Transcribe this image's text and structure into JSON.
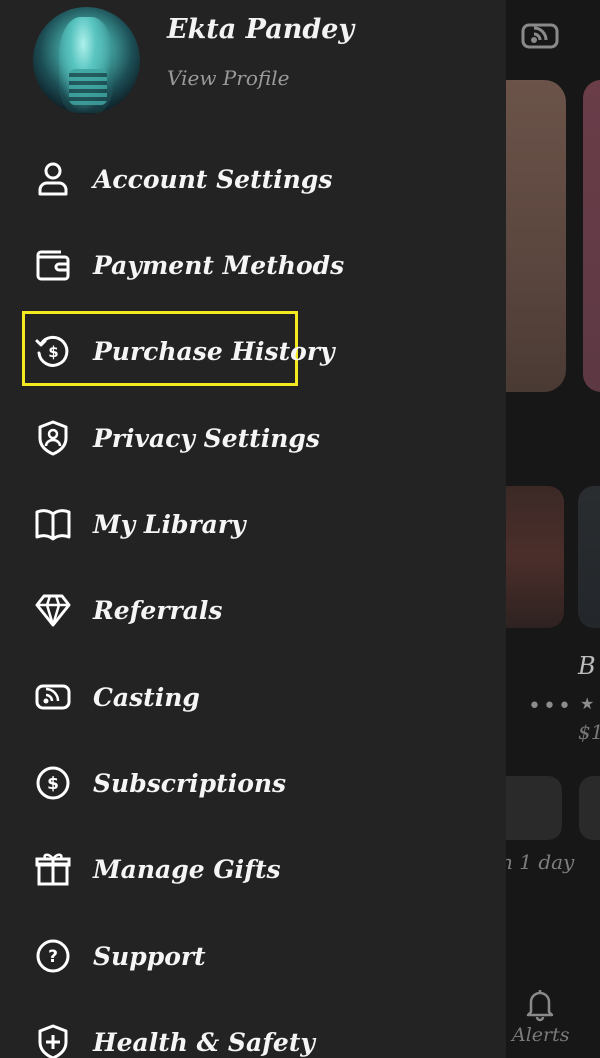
{
  "profile": {
    "name": "Ekta Pandey",
    "view_profile": "View Profile"
  },
  "menu": [
    {
      "label": "Account Settings",
      "icon": "user-icon"
    },
    {
      "label": "Payment Methods",
      "icon": "wallet-icon"
    },
    {
      "label": "Purchase History",
      "icon": "dollar-history-icon",
      "highlighted": true
    },
    {
      "label": "Privacy Settings",
      "icon": "shield-user-icon"
    },
    {
      "label": "My Library",
      "icon": "book-icon"
    },
    {
      "label": "Referrals",
      "icon": "diamond-icon"
    },
    {
      "label": "Casting",
      "icon": "cast-icon"
    },
    {
      "label": "Subscriptions",
      "icon": "dollar-circle-icon"
    },
    {
      "label": "Manage Gifts",
      "icon": "gift-icon"
    },
    {
      "label": "Support",
      "icon": "help-icon"
    },
    {
      "label": "Health & Safety",
      "icon": "shield-plus-icon"
    }
  ],
  "background": {
    "title_fragment": "B",
    "price_fragment": "$1",
    "expiry_fragment": "n 1 day",
    "alerts_label": "Alerts"
  },
  "colors": {
    "drawer_bg": "#232323",
    "highlight_border": "#f4e81f",
    "text": "#f5f5f5"
  }
}
